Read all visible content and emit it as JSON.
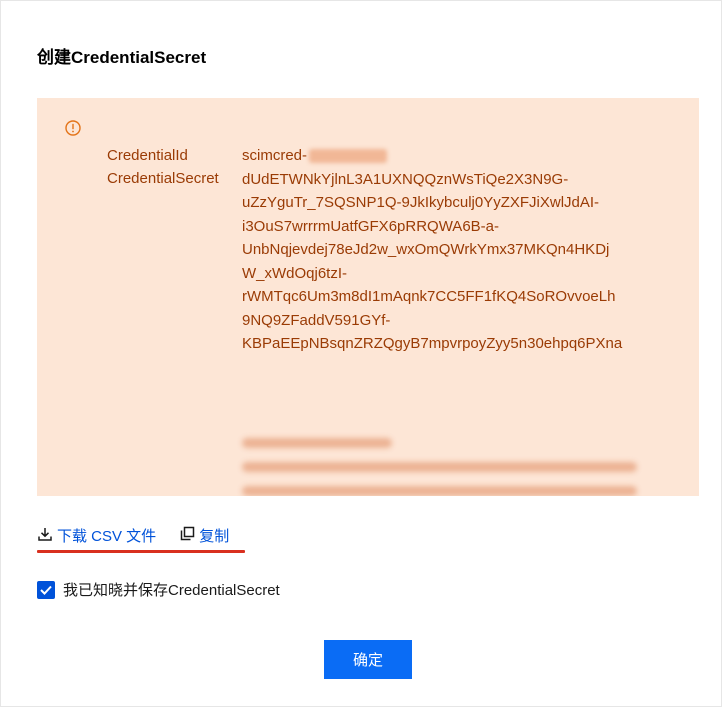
{
  "dialog": {
    "title": "创建CredentialSecret"
  },
  "notice": {
    "icon": "warning-circle-icon",
    "credential_id_label": "CredentialId",
    "credential_id_value": "scimcred-",
    "credential_secret_label": "CredentialSecret",
    "credential_secret_lines": [
      "dUdETWNkYjlnL3A1UXNQQznWsTiQe2X3N9G-",
      "uZzYguTr_7SQSNP1Q-9JkIkybculj0YyZXFJiXwlJdAI-",
      "i3OuS7wrrrmUatfGFX6pRRQWA6B-a-",
      "UnbNqjevdej78eJd2w_wxOmQWrkYmx37MKQn4HKDj",
      "W_xWdOqj6tzI-",
      "rWMTqc6Um3m8dI1mAqnk7CC5FF1fKQ4SoROvvoeLh",
      "9NQ9ZFaddV591GYf-",
      "KBPaEEpNBsqnZRZQgyB7mpvrpoyZyy5n30ehpq6PXna"
    ],
    "colors": {
      "background": "#fde6d6",
      "text": "#9a3b05",
      "icon": "#e37318"
    }
  },
  "actions": {
    "download_icon": "download-icon",
    "download_label": "下载 CSV 文件",
    "copy_icon": "copy-icon",
    "copy_label": "复制",
    "link_color": "#0052d9",
    "underline_color": "#d9301f"
  },
  "acknowledge": {
    "checked": true,
    "label": "我已知晓并保存CredentialSecret"
  },
  "footer": {
    "confirm_label": "确定",
    "confirm_color": "#0a6cf5"
  }
}
